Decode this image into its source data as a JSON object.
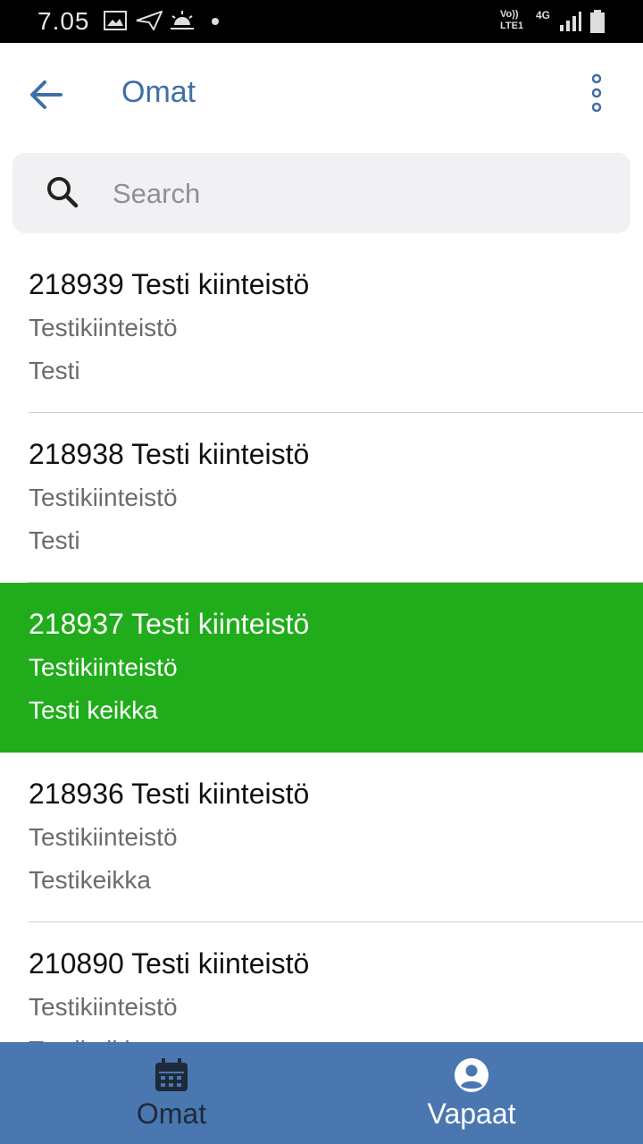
{
  "status_bar": {
    "time": "7.05",
    "network": "Vo)) LTE1",
    "network_type": "4G"
  },
  "header": {
    "title": "Omat"
  },
  "search": {
    "placeholder": "Search",
    "value": ""
  },
  "list": [
    {
      "title": "218939 Testi kiinteistö",
      "subtitle": "Testikiinteistö",
      "detail": "Testi",
      "highlighted": false
    },
    {
      "title": "218938 Testi kiinteistö",
      "subtitle": "Testikiinteistö",
      "detail": "Testi",
      "highlighted": false
    },
    {
      "title": "218937 Testi kiinteistö",
      "subtitle": "Testikiinteistö",
      "detail": "Testi keikka",
      "highlighted": true
    },
    {
      "title": "218936 Testi kiinteistö",
      "subtitle": "Testikiinteistö",
      "detail": "Testikeikka",
      "highlighted": false
    },
    {
      "title": "210890 Testi kiinteistö",
      "subtitle": "Testikiinteistö",
      "detail": "Testikeikka",
      "highlighted": false
    }
  ],
  "bottom_nav": [
    {
      "label": "Omat",
      "icon": "calendar-icon",
      "active": false
    },
    {
      "label": "Vapaat",
      "icon": "account-circle-icon",
      "active": true
    }
  ],
  "colors": {
    "accent": "#3f6fa8",
    "highlight": "#21ad1b",
    "bottom_nav": "#4a77b0"
  }
}
